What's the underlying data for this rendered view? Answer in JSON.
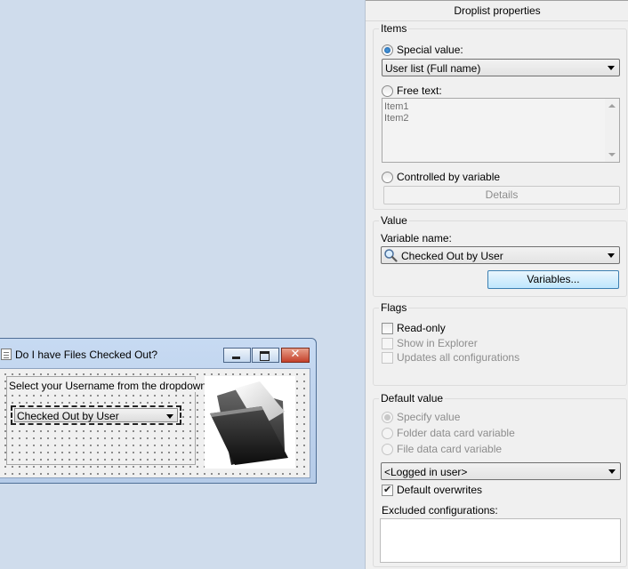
{
  "panel": {
    "title": "Droplist properties",
    "items_group": {
      "legend": "Items",
      "special_value_label": "Special value:",
      "special_value_selected": "User list (Full name)",
      "free_text_label": "Free text:",
      "free_text_lines": [
        "Item1",
        "Item2"
      ],
      "controlled_label": "Controlled by variable",
      "details_button": "Details"
    },
    "value_group": {
      "legend": "Value",
      "variable_name_label": "Variable name:",
      "variable_selected": "Checked Out by User",
      "variables_button": "Variables..."
    },
    "flags_group": {
      "legend": "Flags",
      "read_only": "Read-only",
      "show_in_explorer": "Show in Explorer",
      "updates_all": "Updates all configurations"
    },
    "default_group": {
      "legend": "Default value",
      "specify_value": "Specify value",
      "folder_var": "Folder data card variable",
      "file_var": "File data card variable",
      "default_selected": "<Logged in user>",
      "default_overwrites": "Default overwrites",
      "excluded_label": "Excluded configurations:"
    }
  },
  "dialog": {
    "title": "Do I have Files Checked Out?",
    "prompt": "Select your Username from the dropdown:",
    "combo_value": "Checked Out by User"
  },
  "icons": {
    "search": "magnifier-icon",
    "folder": "folder-icon"
  },
  "colors": {
    "desktop": "#cfdcec",
    "panel": "#f0f0f0",
    "focus_button": "#bee6fd",
    "close_button": "#c4402a"
  }
}
